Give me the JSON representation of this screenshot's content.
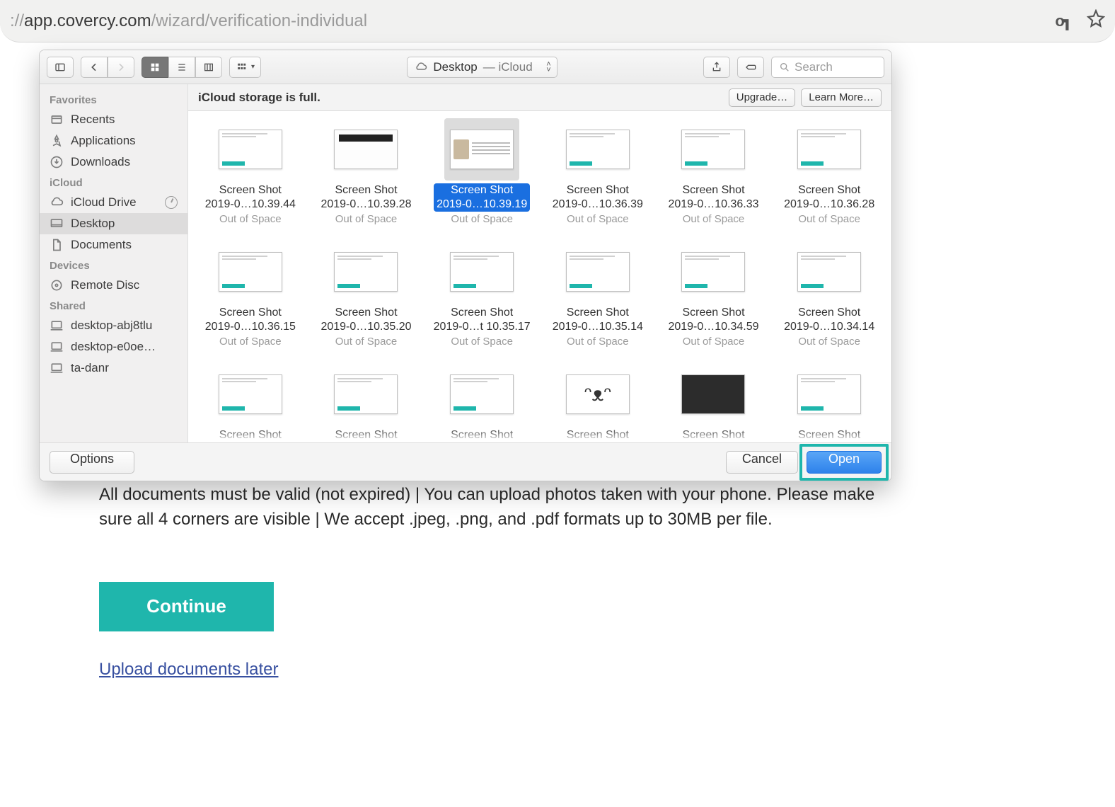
{
  "browser": {
    "url_prefix": "://",
    "url_domain": "app.covercy.com",
    "url_path": "/wizard/verification-individual"
  },
  "page": {
    "instructions": "All documents must be valid (not expired) | You can upload photos taken with your phone. Please make sure all 4 corners are visible | We accept .jpeg, .png, and .pdf formats up to 30MB per file.",
    "continue": "Continue",
    "later_link": "Upload documents later"
  },
  "dialog": {
    "path_location": "Desktop",
    "path_sub": " — iCloud",
    "search_placeholder": "Search",
    "banner_msg": "iCloud storage is full.",
    "upgrade": "Upgrade…",
    "learn_more": "Learn More…",
    "options": "Options",
    "cancel": "Cancel",
    "open": "Open",
    "sidebar": {
      "favorites_header": "Favorites",
      "favorites": [
        {
          "label": "Recents",
          "icon": "recents"
        },
        {
          "label": "Applications",
          "icon": "apps"
        },
        {
          "label": "Downloads",
          "icon": "downloads"
        }
      ],
      "icloud_header": "iCloud",
      "icloud": [
        {
          "label": "iCloud Drive",
          "icon": "cloud",
          "progress": true
        },
        {
          "label": "Desktop",
          "icon": "desktop",
          "selected": true
        },
        {
          "label": "Documents",
          "icon": "docs"
        }
      ],
      "devices_header": "Devices",
      "devices": [
        {
          "label": "Remote Disc",
          "icon": "disc"
        }
      ],
      "shared_header": "Shared",
      "shared": [
        {
          "label": "desktop-abj8tlu",
          "icon": "pc"
        },
        {
          "label": "desktop-e0oe…",
          "icon": "pc"
        },
        {
          "label": "ta-danr",
          "icon": "pc"
        }
      ]
    },
    "files": [
      {
        "l1": "Screen Shot",
        "l2": "2019-0…10.39.44",
        "status": "Out of Space",
        "t": "web"
      },
      {
        "l1": "Screen Shot",
        "l2": "2019-0…10.39.28",
        "status": "Out of Space",
        "t": "card"
      },
      {
        "l1": "Screen Shot",
        "l2": "2019-0…10.39.19",
        "status": "Out of Space",
        "t": "id",
        "selected": true
      },
      {
        "l1": "Screen Shot",
        "l2": "2019-0…10.36.39",
        "status": "Out of Space",
        "t": "web"
      },
      {
        "l1": "Screen Shot",
        "l2": "2019-0…10.36.33",
        "status": "Out of Space",
        "t": "web"
      },
      {
        "l1": "Screen Shot",
        "l2": "2019-0…10.36.28",
        "status": "Out of Space",
        "t": "web"
      },
      {
        "l1": "Screen Shot",
        "l2": "2019-0…10.36.15",
        "status": "Out of Space",
        "t": "web"
      },
      {
        "l1": "Screen Shot",
        "l2": "2019-0…10.35.20",
        "status": "Out of Space",
        "t": "web"
      },
      {
        "l1": "Screen Shot",
        "l2": "2019-0…t 10.35.17",
        "status": "Out of Space",
        "t": "web"
      },
      {
        "l1": "Screen Shot",
        "l2": "2019-0…10.35.14",
        "status": "Out of Space",
        "t": "web"
      },
      {
        "l1": "Screen Shot",
        "l2": "2019-0…10.34.59",
        "status": "Out of Space",
        "t": "web"
      },
      {
        "l1": "Screen Shot",
        "l2": "2019-0…10.34.14",
        "status": "Out of Space",
        "t": "web"
      },
      {
        "l1": "Screen Shot",
        "l2": "",
        "status": "",
        "t": "web"
      },
      {
        "l1": "Screen Shot",
        "l2": "",
        "status": "",
        "t": "web"
      },
      {
        "l1": "Screen Shot",
        "l2": "",
        "status": "",
        "t": "web"
      },
      {
        "l1": "Screen Shot",
        "l2": "",
        "status": "",
        "t": "cat"
      },
      {
        "l1": "Screen Shot",
        "l2": "",
        "status": "",
        "t": "dark"
      },
      {
        "l1": "Screen Shot",
        "l2": "",
        "status": "",
        "t": "web"
      }
    ]
  }
}
